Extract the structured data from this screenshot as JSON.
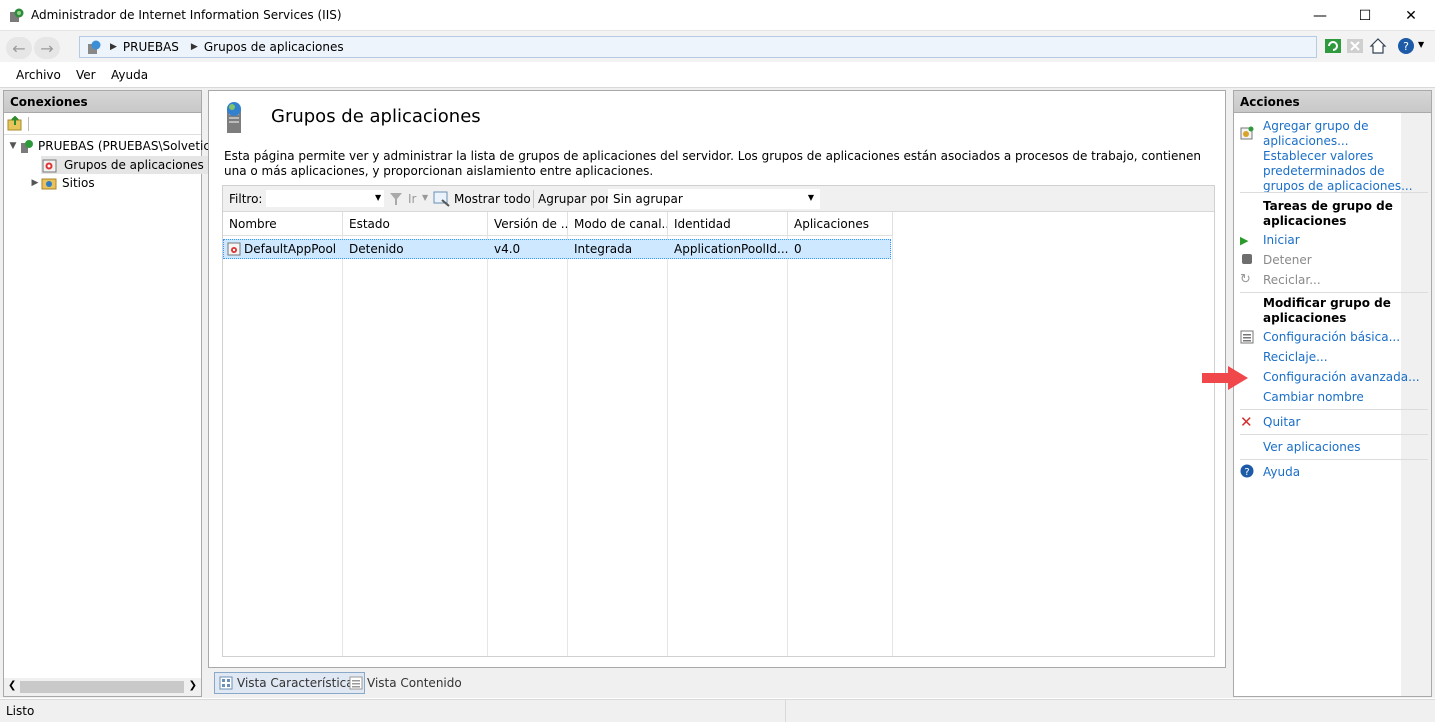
{
  "window": {
    "title": "Administrador de Internet Information Services (IIS)"
  },
  "address": {
    "crumbs": [
      "PRUEBAS",
      "Grupos de aplicaciones"
    ]
  },
  "menu": {
    "items": [
      "Archivo",
      "Ver",
      "Ayuda"
    ]
  },
  "connections": {
    "header": "Conexiones",
    "server": "PRUEBAS (PRUEBAS\\Solvetic)",
    "pools": "Grupos de aplicaciones",
    "sites": "Sitios"
  },
  "main": {
    "title": "Grupos de aplicaciones",
    "description": "Esta página permite ver y administrar la lista de grupos de aplicaciones del servidor. Los grupos de aplicaciones están asociados a procesos de trabajo, contienen una o más aplicaciones, y proporcionan aislamiento entre aplicaciones.",
    "filter": {
      "label": "Filtro:",
      "go": "Ir",
      "show_all": "Mostrar todo",
      "group_by_label": "Agrupar por:",
      "group_by_value": "Sin agrupar"
    },
    "columns": [
      "Nombre",
      "Estado",
      "Versión de ...",
      "Modo de canal...",
      "Identidad",
      "Aplicaciones"
    ],
    "rows": [
      {
        "name": "DefaultAppPool",
        "state": "Detenido",
        "version": "v4.0",
        "mode": "Integrada",
        "identity": "ApplicationPoolId...",
        "apps": "0"
      }
    ],
    "tabs": {
      "features": "Vista Características",
      "content": "Vista Contenido"
    }
  },
  "actions": {
    "header": "Acciones",
    "add_pool": "Agregar grupo de aplicaciones...",
    "set_defaults": "Establecer valores predeterminados de grupos de aplicaciones...",
    "tasks_heading": "Tareas de grupo de aplicaciones",
    "start": "Iniciar",
    "stop": "Detener",
    "recycle": "Reciclar...",
    "edit_heading": "Modificar grupo de aplicaciones",
    "basic_settings": "Configuración básica...",
    "recycling": "Reciclaje...",
    "advanced_settings": "Configuración avanzada...",
    "rename": "Cambiar nombre",
    "remove": "Quitar",
    "view_apps": "Ver aplicaciones",
    "help": "Ayuda"
  },
  "status": {
    "text": "Listo"
  },
  "colors": {
    "link": "#1a6ec7",
    "selection": "#cde8ff",
    "annotation_arrow": "#f0474b"
  }
}
